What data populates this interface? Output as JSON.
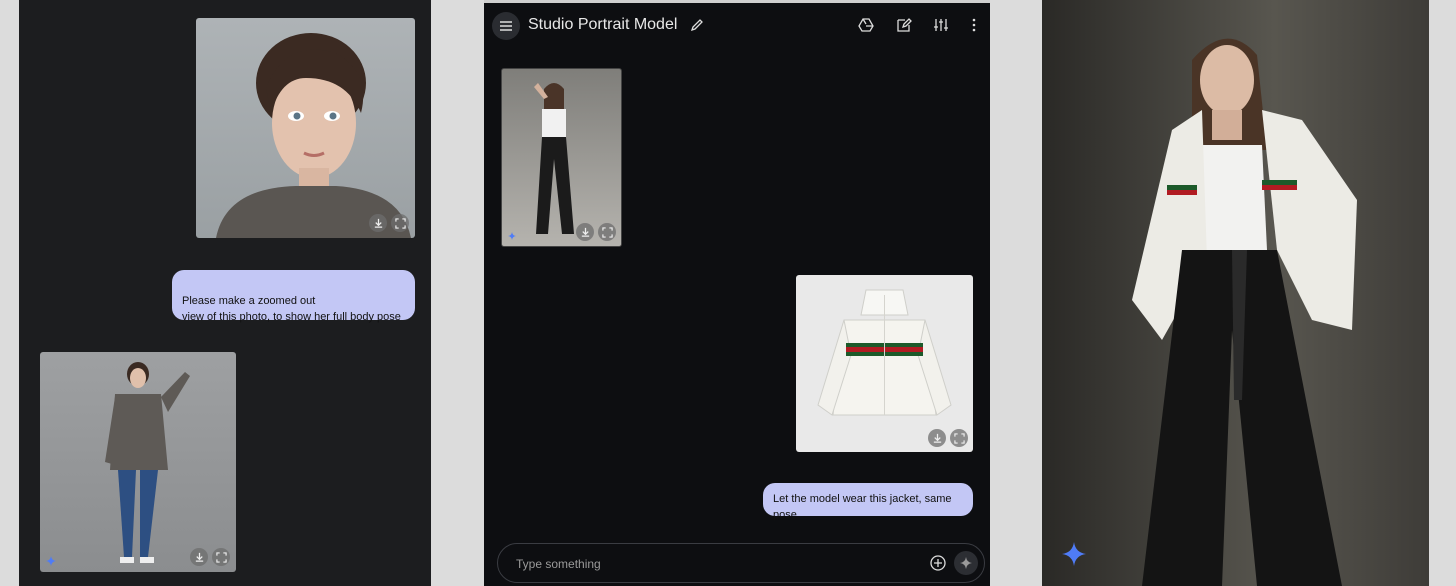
{
  "panel1": {
    "prompt": "Please make a zoomed out\nview of this photo, to show her full body pose"
  },
  "panel2": {
    "title": "Studio Portrait Model",
    "prompt": "Let the model wear this jacket, same pose",
    "composer_placeholder": "Type something"
  },
  "colors": {
    "bubble": "#c3c7f5",
    "spark": "#4f7cf7"
  }
}
